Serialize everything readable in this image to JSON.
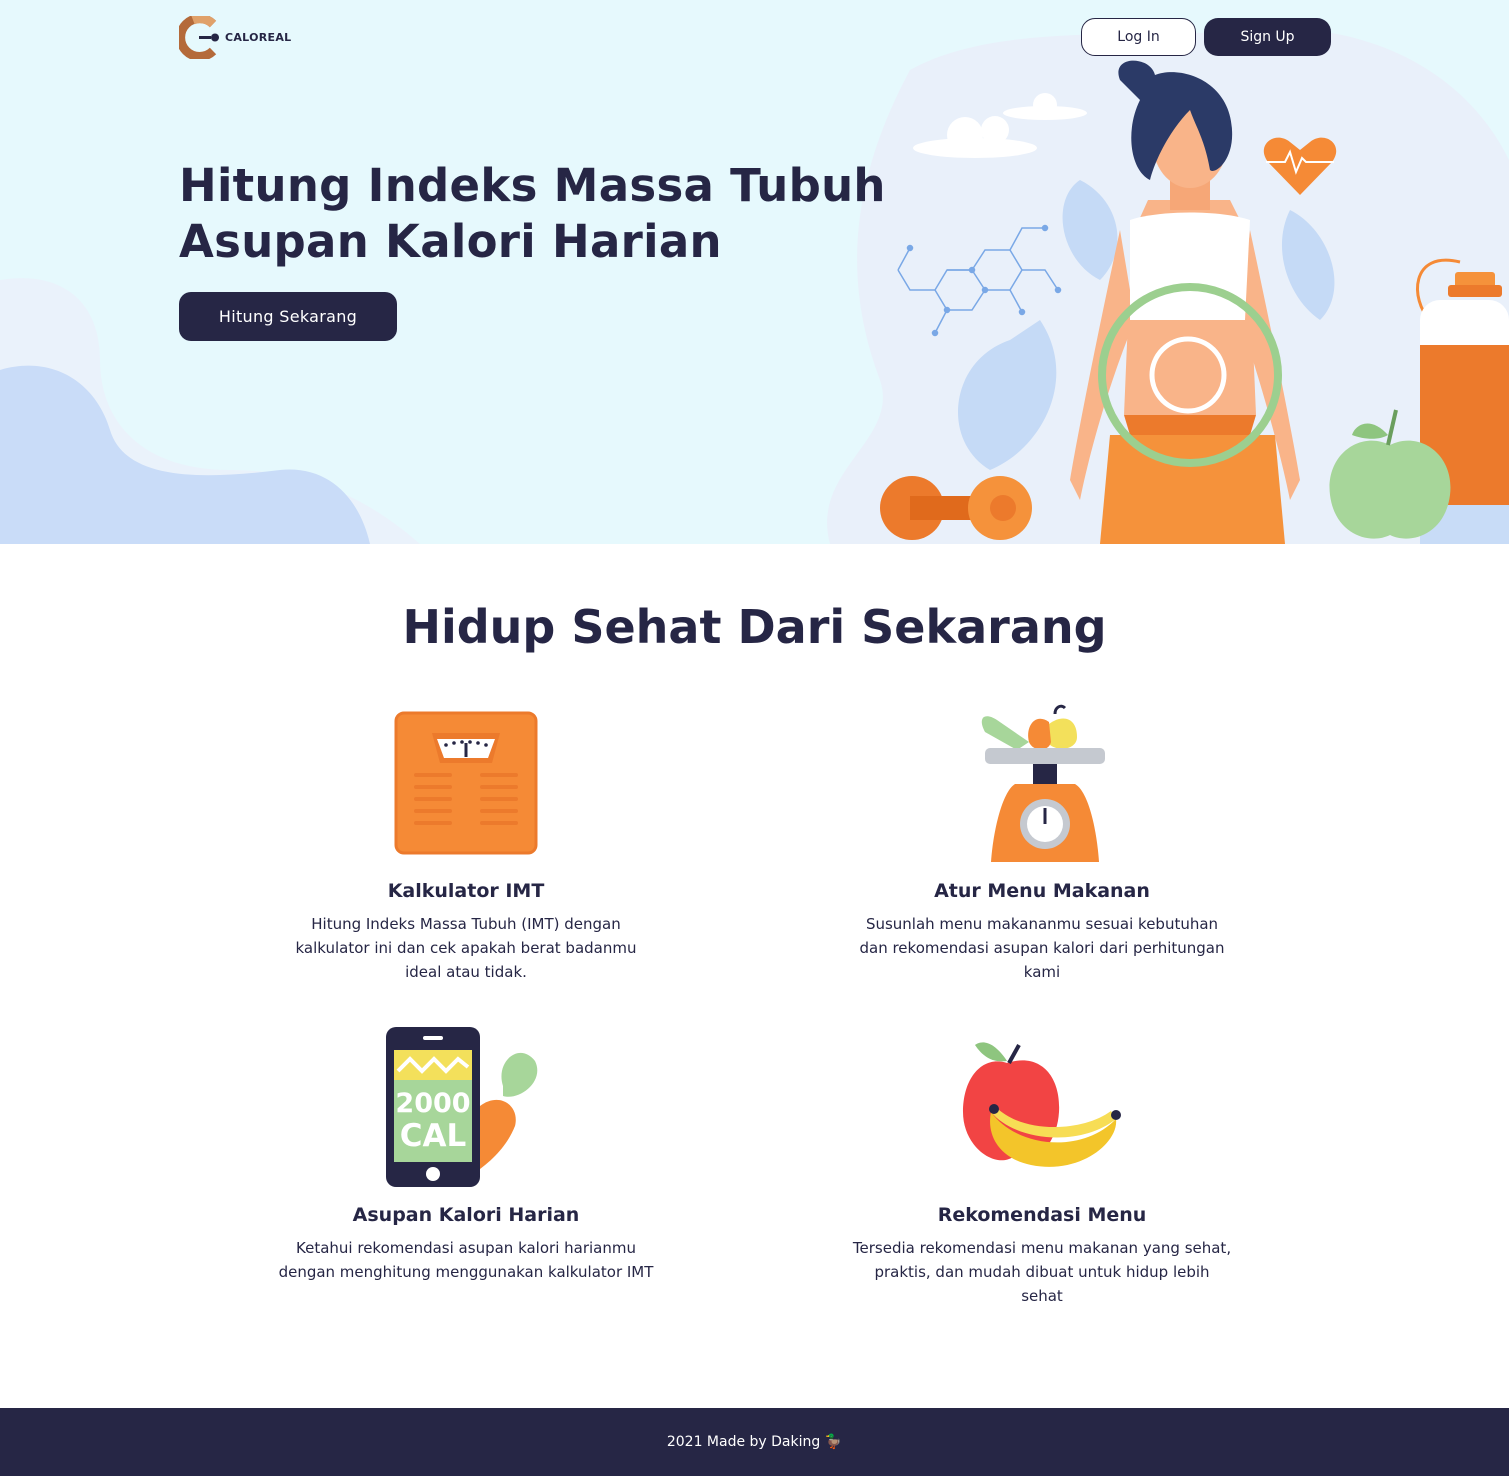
{
  "brand": {
    "name": "CALOREAL",
    "logo_icon": "c-logo-icon"
  },
  "nav": {
    "login_label": "Log In",
    "signup_label": "Sign Up"
  },
  "hero": {
    "title_line1": "Hitung Indeks Massa Tubuh",
    "title_line2": "Asupan Kalori Harian",
    "cta_label": "Hitung Sekarang",
    "illustration": "woman-metabolism-illustration"
  },
  "section": {
    "title": "Hidup Sehat Dari Sekarang"
  },
  "features": [
    {
      "icon": "bathroom-scale-icon",
      "title": "Kalkulator IMT",
      "description": "Hitung Indeks Massa Tubuh (IMT) dengan kalkulator ini dan cek apakah berat badanmu ideal atau tidak."
    },
    {
      "icon": "food-scale-icon",
      "title": "Atur Menu Makanan",
      "description": "Susunlah menu makananmu sesuai kebutuhan dan rekomendasi asupan kalori dari perhitungan kami"
    },
    {
      "icon": "calorie-phone-icon",
      "title": "Asupan Kalori Harian",
      "description": "Ketahui rekomendasi asupan kalori harianmu dengan menghitung menggunakan kalkulator IMT",
      "icon_text_1": "2000",
      "icon_text_2": "CAL"
    },
    {
      "icon": "apple-banana-icon",
      "title": "Rekomendasi Menu",
      "description": "Tersedia rekomendasi menu makanan yang sehat, praktis, dan mudah dibuat untuk hidup lebih sehat"
    }
  ],
  "footer": {
    "text": "2021 Made by Daking 🦆"
  },
  "colors": {
    "primary": "#262645",
    "hero_bg": "#e6f9fd",
    "accent_orange": "#f58a36",
    "accent_green": "#9ccf8f",
    "accent_blue": "#c8dcf7"
  }
}
